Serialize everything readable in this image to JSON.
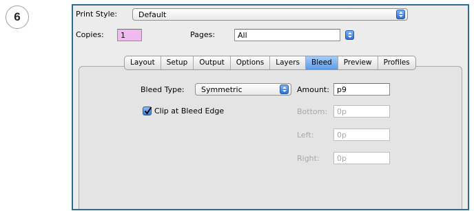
{
  "step": "6",
  "print_style": {
    "label": "Print Style:",
    "value": "Default"
  },
  "copies": {
    "label": "Copies:",
    "value": "1"
  },
  "pages": {
    "label": "Pages:",
    "value": "All"
  },
  "tabs": [
    {
      "label": "Layout",
      "active": false
    },
    {
      "label": "Setup",
      "active": false
    },
    {
      "label": "Output",
      "active": false
    },
    {
      "label": "Options",
      "active": false
    },
    {
      "label": "Layers",
      "active": false
    },
    {
      "label": "Bleed",
      "active": true
    },
    {
      "label": "Preview",
      "active": false
    },
    {
      "label": "Profiles",
      "active": false
    }
  ],
  "bleed": {
    "type_label": "Bleed Type:",
    "type_value": "Symmetric",
    "amount_label": "Amount:",
    "amount_value": "p9",
    "clip_label": "Clip at Bleed Edge",
    "clip_checked": true,
    "bottom_label": "Bottom:",
    "bottom_value": "0p",
    "left_label": "Left:",
    "left_value": "0p",
    "right_label": "Right:",
    "right_value": "0p"
  },
  "colors": {
    "dialog_border": "#2c6b8f",
    "active_tab": "#5c9be6",
    "copies_field": "#f0b9ef"
  }
}
